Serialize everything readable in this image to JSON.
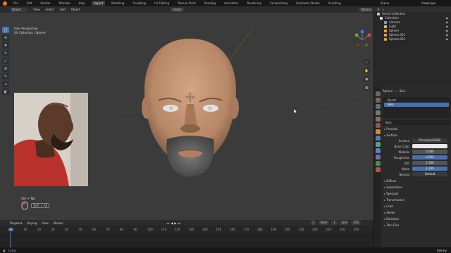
{
  "topbar": {
    "menus": [
      "File",
      "Edit",
      "Render",
      "Window",
      "Help"
    ],
    "workspaces": [
      "Layout",
      "Modeling",
      "Sculpting",
      "UV Editing",
      "Texture Paint",
      "Shading",
      "Animation",
      "Rendering",
      "Compositing",
      "Geometry Nodes",
      "Scripting"
    ],
    "active_workspace": "Layout",
    "scene": "Scene",
    "view_layer": "ViewLayer"
  },
  "viewport_header": {
    "mode": "Object Mode",
    "menus": [
      "View",
      "Select",
      "Add",
      "Object"
    ],
    "orientation": "Global",
    "options": "Options"
  },
  "viewport": {
    "perspective": "User Perspective",
    "collection": "(0) Collection | Sphere"
  },
  "keys": {
    "combo1": "Ctrl + Tab",
    "combo2": "Shift + A0"
  },
  "outliner": {
    "root": "Scene Collection",
    "collection": "Collection",
    "items": [
      {
        "name": "Camera",
        "color": "#6fa8dc"
      },
      {
        "name": "Light",
        "color": "#e8c34a"
      },
      {
        "name": "Sphere",
        "color": "#f0a030"
      },
      {
        "name": "Sphere.001",
        "color": "#f0a030"
      },
      {
        "name": "Sphere.002",
        "color": "#f0a030"
      }
    ]
  },
  "properties": {
    "object": "Sphere",
    "material": "Skin",
    "slots": [
      "Beard",
      "Skin"
    ],
    "material_field": "Skin",
    "preview": "Preview",
    "surface": "Surface",
    "surface_shader": "Principled BSDF",
    "fields": [
      {
        "label": "Base Color",
        "value": "",
        "style": "white"
      },
      {
        "label": "Metallic",
        "value": "0.000",
        "style": "grey"
      },
      {
        "label": "Roughness",
        "value": "0.500",
        "style": "blue"
      },
      {
        "label": "IOR",
        "value": "1.500",
        "style": "grey"
      },
      {
        "label": "Alpha",
        "value": "1.000",
        "style": "blue"
      },
      {
        "label": "Normal",
        "value": "Default",
        "style": "dark"
      }
    ],
    "panels": [
      "Diffuse",
      "Subsurface",
      "Specular",
      "Transmission",
      "Coat",
      "Sheen",
      "Emission",
      "Thin Film"
    ]
  },
  "timeline": {
    "menus": [
      "Playback",
      "Keying",
      "View",
      "Marker"
    ],
    "current_frame": "1",
    "start_label": "Start",
    "start": "1",
    "end_label": "End",
    "end": "250",
    "ticks": [
      "0",
      "10",
      "20",
      "30",
      "40",
      "50",
      "60",
      "70",
      "80",
      "90",
      "100",
      "110",
      "120",
      "130",
      "140",
      "150",
      "160",
      "170",
      "180",
      "190",
      "200",
      "210",
      "220",
      "230",
      "240",
      "250"
    ]
  },
  "status": {
    "left": "Lasso",
    "watermark": "Udemy"
  },
  "colors": {
    "accent": "#4772b3",
    "skin": "#c29473",
    "beard": "#6b6b6b"
  }
}
